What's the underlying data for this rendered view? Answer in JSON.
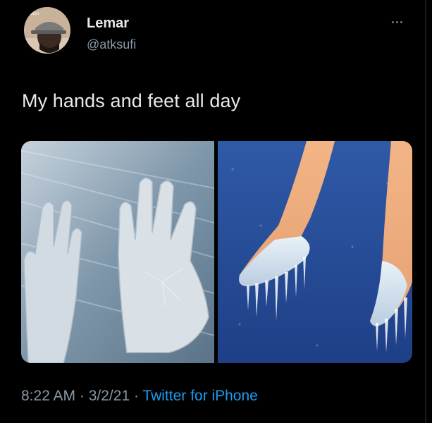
{
  "user": {
    "display_name": "Lemar",
    "handle": "@atksufi",
    "avatar_icon": "profile-photo"
  },
  "menu_icon": "more-options-icon",
  "tweet": {
    "text": "My hands and feet all day",
    "media": [
      {
        "alt": "frozen hands",
        "icon": "frozen-hands-image"
      },
      {
        "alt": "frozen feet with icicles",
        "icon": "frozen-feet-image"
      }
    ]
  },
  "meta": {
    "time": "8:22 AM",
    "separator1": " · ",
    "date": "3/2/21",
    "separator2": " · ",
    "source": "Twitter for iPhone"
  },
  "colors": {
    "background": "#000000",
    "text": "#e7e9ea",
    "muted": "#8b98a5",
    "link": "#1d9bf0"
  }
}
